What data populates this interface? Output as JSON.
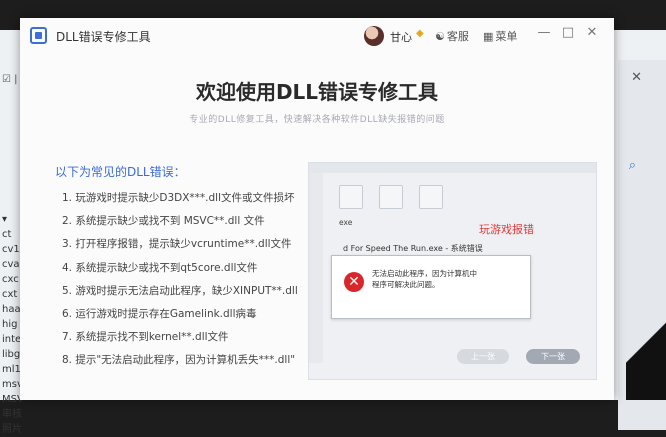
{
  "background": {
    "left_top_label": "☑ | 程",
    "sidebar_items": [
      "▾",
      "ct",
      "cv1",
      "cva",
      "cxc",
      "cxt",
      "haa",
      "hig",
      "inte",
      "libg",
      "ml1",
      "msv",
      "MSV",
      "审核",
      "照片"
    ],
    "close_glyph": "✕",
    "search_glyph": "⌕"
  },
  "app": {
    "title": "DLL错误专修工具",
    "user_name": "甘心",
    "feedback_label": "客服",
    "menu_label": "菜单",
    "headline": "欢迎使用DLL错误专修工具",
    "subline": "专业的DLL修复工具，快速解决各种软件DLL缺失报错的问题",
    "list_title": "以下为常见的DLL错误：",
    "errors": [
      "1. 玩游戏时提示缺少D3DX***.dll文件或文件损坏",
      "2. 系统提示缺少或找不到 MSVC**.dll 文件",
      "3. 打开程序报错，提示缺少vcruntime**.dll文件",
      "4. 系统提示缺少或找不到qt5core.dll文件",
      "5. 游戏时提示无法启动此程序，缺少XINPUT**.dll",
      "6. 运行游戏时提示存在Gamelink.dll病毒",
      "7. 系统提示找不到kernel**.dll文件",
      "8. 提示\"无法启动此程序，因为计算机丢失***.dll\""
    ],
    "example": {
      "file_name": "exe",
      "window_title": "d For Speed The Run.exe - 系统错误",
      "dialog_text": "无法启动此程序，因为计算机中\n程序可解决此问题。",
      "caption": "玩游戏报错",
      "prev_label": "上一张",
      "next_label": "下一张"
    }
  },
  "colors": {
    "accent": "#3a6bd9",
    "error_red": "#d9262b",
    "caption_red": "#e23a3a"
  }
}
